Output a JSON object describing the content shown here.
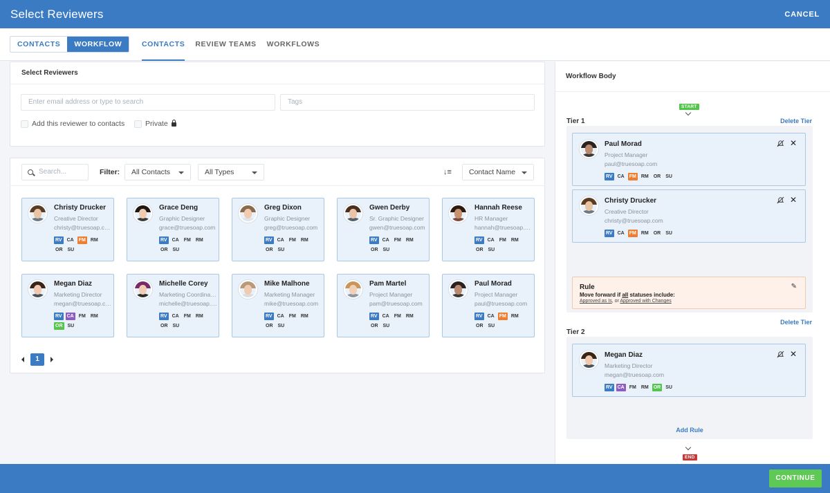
{
  "header": {
    "title": "Select Reviewers",
    "cancel": "CANCEL"
  },
  "segment": {
    "contacts": "CONTACTS",
    "workflow": "WORKFLOW"
  },
  "tabs": [
    "CONTACTS",
    "REVIEW TEAMS",
    "WORKFLOWS"
  ],
  "select_panel": {
    "title": "Select Reviewers",
    "email_placeholder": "Enter email address or type to search",
    "tags_placeholder": "Tags",
    "add_to_contacts": "Add this reviewer to contacts",
    "private": "Private"
  },
  "contacts_panel": {
    "search_placeholder": "Search...",
    "filter_label": "Filter:",
    "filter_contacts": "All Contacts",
    "filter_types": "All Types",
    "sort": "Contact Name",
    "page": "1"
  },
  "contacts": [
    {
      "name": "Christy Drucker",
      "role": "Creative Director",
      "email": "christy@truesoap.com",
      "badges": [
        [
          "RV",
          "blue"
        ],
        [
          "CA",
          ""
        ],
        [
          "FM",
          "orange"
        ],
        [
          "RM",
          ""
        ],
        [
          "OR",
          ""
        ],
        [
          "SU",
          ""
        ]
      ],
      "hair": "#5a3b24",
      "skin": "#e8c3a4",
      "shirt": "#6b7a86"
    },
    {
      "name": "Grace Deng",
      "role": "Graphic Designer",
      "email": "grace@truesoap.com",
      "badges": [
        [
          "RV",
          "blue"
        ],
        [
          "CA",
          ""
        ],
        [
          "FM",
          ""
        ],
        [
          "RM",
          ""
        ],
        [
          "OR",
          ""
        ],
        [
          "SU",
          ""
        ]
      ],
      "hair": "#1e1714",
      "skin": "#f0cdb0",
      "shirt": "#3b3b3b"
    },
    {
      "name": "Greg Dixon",
      "role": "Graphic Designer",
      "email": "greg@truesoap.com",
      "badges": [
        [
          "RV",
          "blue"
        ],
        [
          "CA",
          ""
        ],
        [
          "FM",
          ""
        ],
        [
          "RM",
          ""
        ],
        [
          "OR",
          ""
        ],
        [
          "SU",
          ""
        ]
      ],
      "hair": "#8a6a4a",
      "skin": "#f1cbb0",
      "shirt": "#dfe4ea"
    },
    {
      "name": "Gwen Derby",
      "role": "Sr. Graphic Designer",
      "email": "gwen@truesoap.com",
      "badges": [
        [
          "RV",
          "blue"
        ],
        [
          "CA",
          ""
        ],
        [
          "FM",
          ""
        ],
        [
          "RM",
          ""
        ],
        [
          "OR",
          ""
        ],
        [
          "SU",
          ""
        ]
      ],
      "hair": "#4a2e1e",
      "skin": "#eac4a8",
      "shirt": "#55606b"
    },
    {
      "name": "Hannah Reese",
      "role": "HR Manager",
      "email": "hannah@truesoap.com",
      "badges": [
        [
          "RV",
          "blue"
        ],
        [
          "CA",
          ""
        ],
        [
          "FM",
          ""
        ],
        [
          "RM",
          ""
        ],
        [
          "OR",
          ""
        ],
        [
          "SU",
          ""
        ]
      ],
      "hair": "#2a1a12",
      "skin": "#c9926e",
      "shirt": "#7a4a3a"
    },
    {
      "name": "Megan Diaz",
      "role": "Marketing Director",
      "email": "megan@truesoap.com",
      "badges": [
        [
          "RV",
          "blue"
        ],
        [
          "CA",
          "purple"
        ],
        [
          "FM",
          ""
        ],
        [
          "RM",
          ""
        ],
        [
          "OR",
          "green"
        ],
        [
          "SU",
          ""
        ]
      ],
      "hair": "#3a2418",
      "skin": "#efc8ad",
      "shirt": "#49535e"
    },
    {
      "name": "Michelle Corey",
      "role": "Marketing Coordinator",
      "email": "michelle@truesoap.com",
      "badges": [
        [
          "RV",
          "blue"
        ],
        [
          "CA",
          ""
        ],
        [
          "FM",
          ""
        ],
        [
          "RM",
          ""
        ],
        [
          "OR",
          ""
        ],
        [
          "SU",
          ""
        ]
      ],
      "hair": "#7a2a6a",
      "skin": "#f0cdb5",
      "shirt": "#2a2a2a"
    },
    {
      "name": "Mike Malhone",
      "role": "Marketing Manager",
      "email": "mike@truesoap.com",
      "badges": [
        [
          "RV",
          "blue"
        ],
        [
          "CA",
          ""
        ],
        [
          "FM",
          ""
        ],
        [
          "RM",
          ""
        ],
        [
          "OR",
          ""
        ],
        [
          "SU",
          ""
        ]
      ],
      "hair": "#b89a7a",
      "skin": "#f0cbb0",
      "shirt": "#d8dde3"
    },
    {
      "name": "Pam Martel",
      "role": "Project Manager",
      "email": "pam@truesoap.com",
      "badges": [
        [
          "RV",
          "blue"
        ],
        [
          "CA",
          ""
        ],
        [
          "FM",
          ""
        ],
        [
          "RM",
          ""
        ],
        [
          "OR",
          ""
        ],
        [
          "SU",
          ""
        ]
      ],
      "hair": "#c8955a",
      "skin": "#f2d0b5",
      "shirt": "#8a96a2"
    },
    {
      "name": "Paul Morad",
      "role": "Project Manager",
      "email": "paul@truesoap.com",
      "badges": [
        [
          "RV",
          "blue"
        ],
        [
          "CA",
          ""
        ],
        [
          "FM",
          "orange"
        ],
        [
          "RM",
          ""
        ],
        [
          "OR",
          ""
        ],
        [
          "SU",
          ""
        ]
      ],
      "hair": "#2a2220",
      "skin": "#b98a6e",
      "shirt": "#3a3a3a"
    }
  ],
  "workflow": {
    "title": "Workflow Body",
    "start": "START",
    "end": "END",
    "delete_tier": "Delete Tier",
    "add_rule": "Add Rule",
    "tier1": {
      "label": "Tier 1",
      "reviewers": [
        {
          "name": "Paul Morad",
          "role": "Project Manager",
          "email": "paul@truesoap.com",
          "badges": [
            [
              "RV",
              "blue"
            ],
            [
              "CA",
              ""
            ],
            [
              "FM",
              "orange"
            ],
            [
              "RM",
              ""
            ],
            [
              "OR",
              ""
            ],
            [
              "SU",
              ""
            ]
          ],
          "hair": "#2a2220",
          "skin": "#b98a6e",
          "shirt": "#3a3a3a"
        },
        {
          "name": "Christy Drucker",
          "role": "Creative Director",
          "email": "christy@truesoap.com",
          "badges": [
            [
              "RV",
              "blue"
            ],
            [
              "CA",
              ""
            ],
            [
              "FM",
              "orange"
            ],
            [
              "RM",
              ""
            ],
            [
              "OR",
              ""
            ],
            [
              "SU",
              ""
            ]
          ],
          "hair": "#5a3b24",
          "skin": "#e8c3a4",
          "shirt": "#6b7a86"
        }
      ],
      "rule": {
        "title": "Rule",
        "desc_pre": "Move forward if ",
        "desc_em": "all",
        "desc_post": " statuses include:",
        "link1": "Approved as Is",
        "sep": ", or ",
        "link2": "Approved with Changes"
      }
    },
    "tier2": {
      "label": "Tier 2",
      "reviewers": [
        {
          "name": "Megan Diaz",
          "role": "Marketing Director",
          "email": "megan@truesoap.com",
          "badges": [
            [
              "RV",
              "blue"
            ],
            [
              "CA",
              "purple"
            ],
            [
              "FM",
              ""
            ],
            [
              "RM",
              ""
            ],
            [
              "OR",
              "green"
            ],
            [
              "SU",
              ""
            ]
          ],
          "hair": "#3a2418",
          "skin": "#efc8ad",
          "shirt": "#49535e"
        }
      ]
    }
  },
  "footer": {
    "continue": "CONTINUE"
  }
}
